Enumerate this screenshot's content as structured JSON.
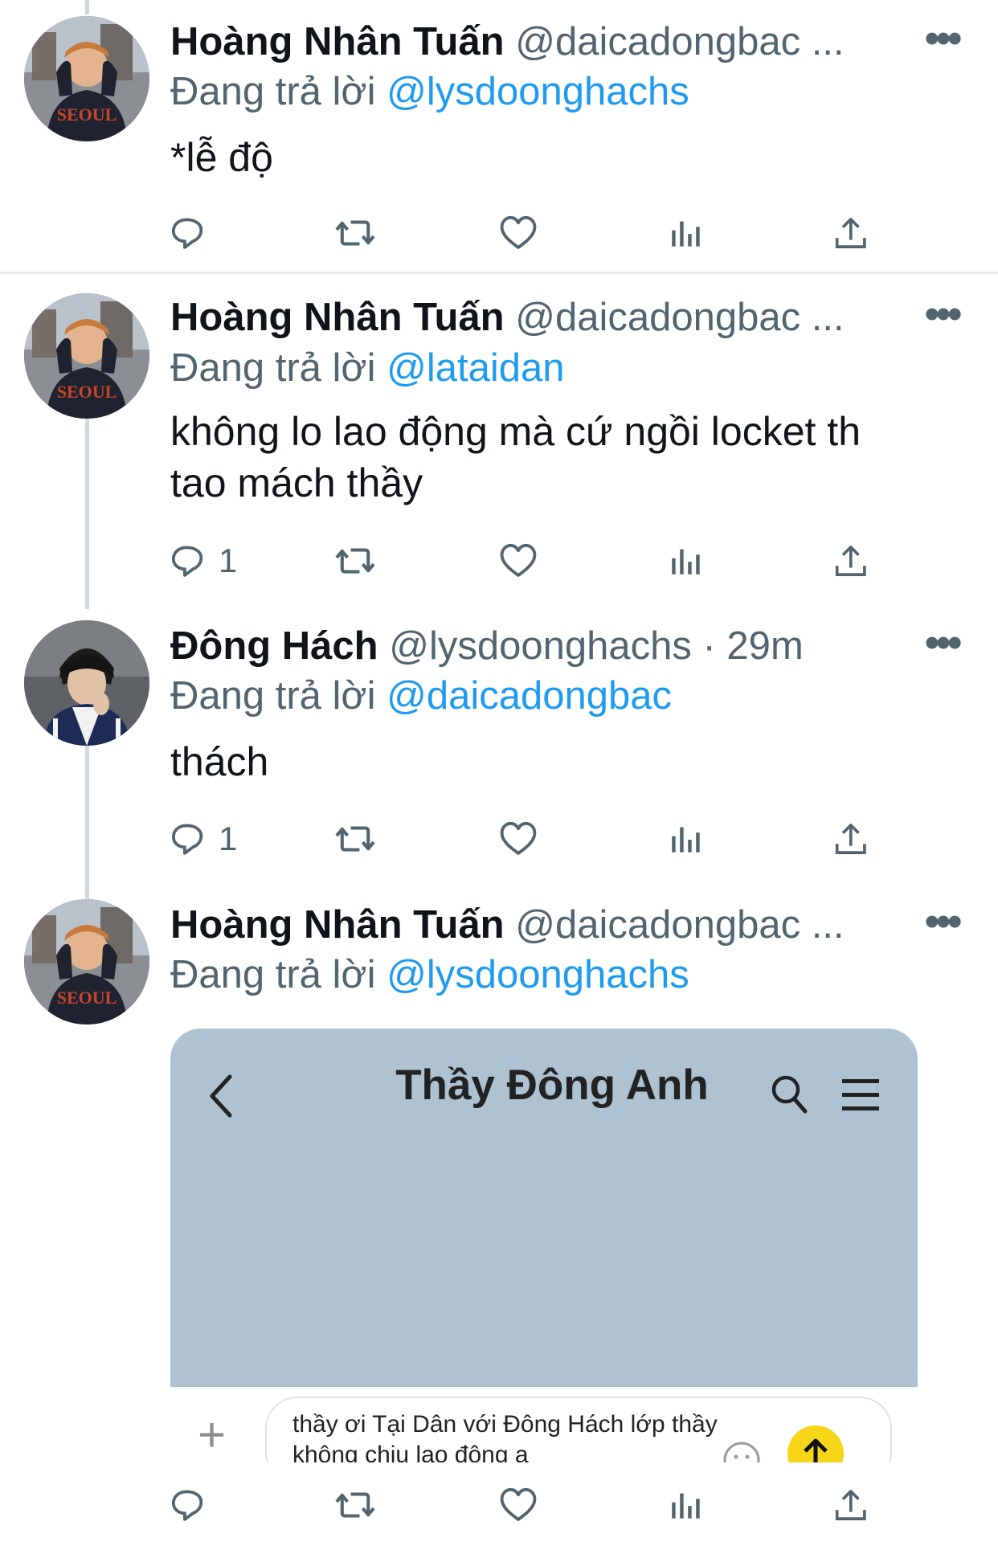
{
  "tweets": [
    {
      "name": "Hoàng Nhân Tuấn",
      "handle": "@daicadongbac ...",
      "reply_prefix": "Đang trả lời ",
      "reply_mention": "@lysdoonghachs",
      "text_lines": [
        "*lễ độ"
      ],
      "reply_count": "",
      "avatar": "avatar-tuan"
    },
    {
      "name": "Hoàng Nhân Tuấn",
      "handle": "@daicadongbac ...",
      "reply_prefix": "Đang trả lời ",
      "reply_mention": "@lataidan",
      "text_lines": [
        "không lo lao động mà cứ ngồi locket th",
        "tao mách thầy"
      ],
      "reply_count": "1",
      "avatar": "avatar-tuan"
    },
    {
      "name": "Đông Hách",
      "handle": "@lysdoonghachs · 29m",
      "reply_prefix": "Đang trả lời ",
      "reply_mention": "@daicadongbac",
      "text_lines": [
        "thách"
      ],
      "reply_count": "1",
      "avatar": "avatar-hach"
    },
    {
      "name": "Hoàng Nhân Tuấn",
      "handle": "@daicadongbac ...",
      "reply_prefix": "Đang trả lời ",
      "reply_mention": "@lysdoonghachs",
      "text_lines": [],
      "reply_count": "",
      "avatar": "avatar-tuan"
    }
  ],
  "more_label": "•••",
  "media": {
    "chat_title": "Thầy Đông Anh",
    "message_line1": "thầy ơi Tại Dân với Đông Hách lớp thầy",
    "message_line2": "không chịu lao động ạ",
    "plus_label": "+"
  },
  "colors": {
    "mention": "#1d9bf0",
    "secondary_text": "#536471",
    "media_bg": "#afc2d2",
    "send_button": "#f7d518"
  }
}
